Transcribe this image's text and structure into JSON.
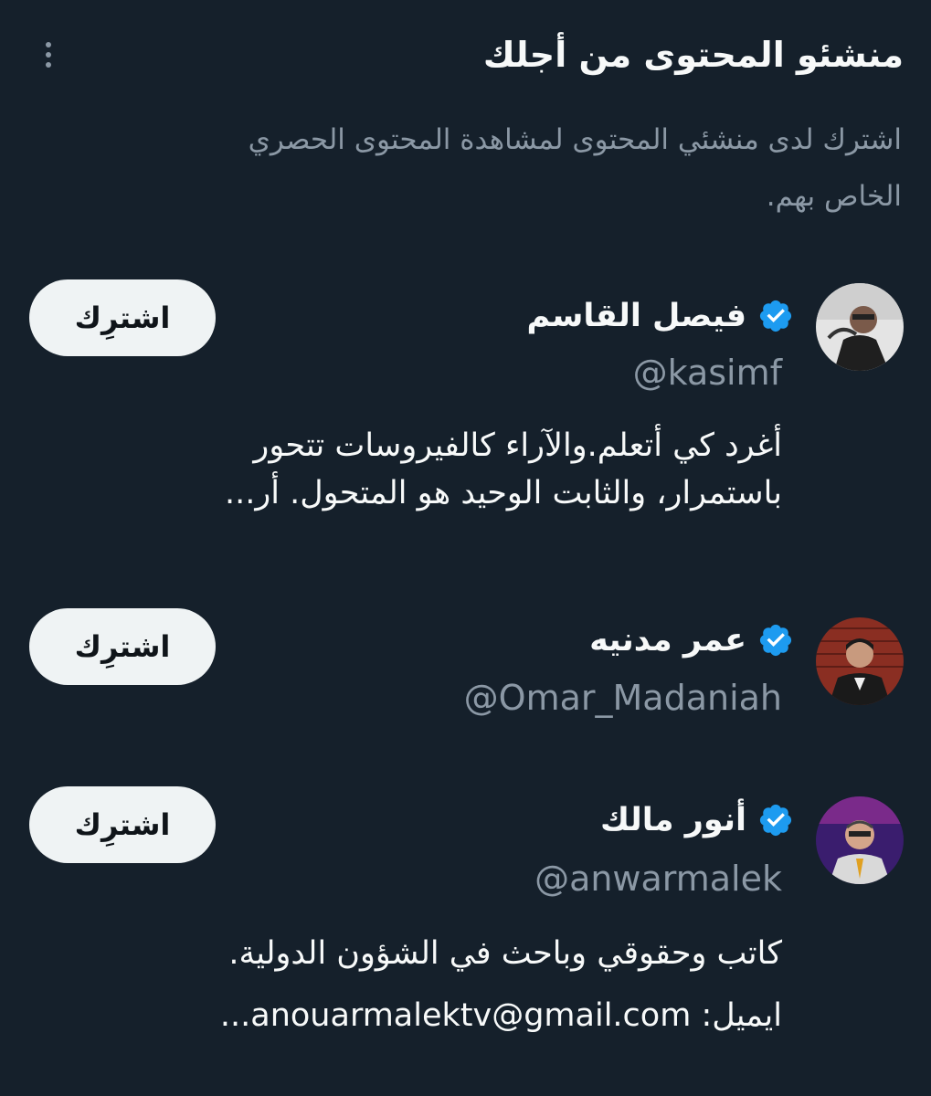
{
  "header": {
    "title": "منشئو المحتوى من أجلك",
    "subtitle": "اشترك لدى منشئي المحتوى لمشاهدة المحتوى الحصري الخاص بهم.",
    "more_icon": "more-vertical-icon"
  },
  "creators": [
    {
      "name": "فيصل القاسم",
      "handle": "@kasimf",
      "verified": true,
      "bio_lines": [
        "أغرد كي أتعلم.والآراء كالفيروسات تتحور",
        "باستمرار، والثابت الوحيد هو المتحول. أر..."
      ],
      "button": "اشترِك"
    },
    {
      "name": "عمر مدنيه",
      "handle": "@Omar_Madaniah",
      "verified": true,
      "bio_lines": [],
      "button": "اشترِك"
    },
    {
      "name": "أنور مالك",
      "handle": "@anwarmalek",
      "verified": true,
      "bio_lines": [
        "كاتب وحقوقي وباحث في الشؤون الدولية.",
        "ايميل: anouarmalektv@gmail.com..."
      ],
      "button": "اشترِك"
    }
  ],
  "colors": {
    "background": "#15202b",
    "primary_text": "#f7f9f9",
    "secondary_text": "#8b98a5",
    "verified_badge": "#1d9bf0",
    "button_bg": "#eff3f4",
    "button_text": "#0f1419"
  }
}
